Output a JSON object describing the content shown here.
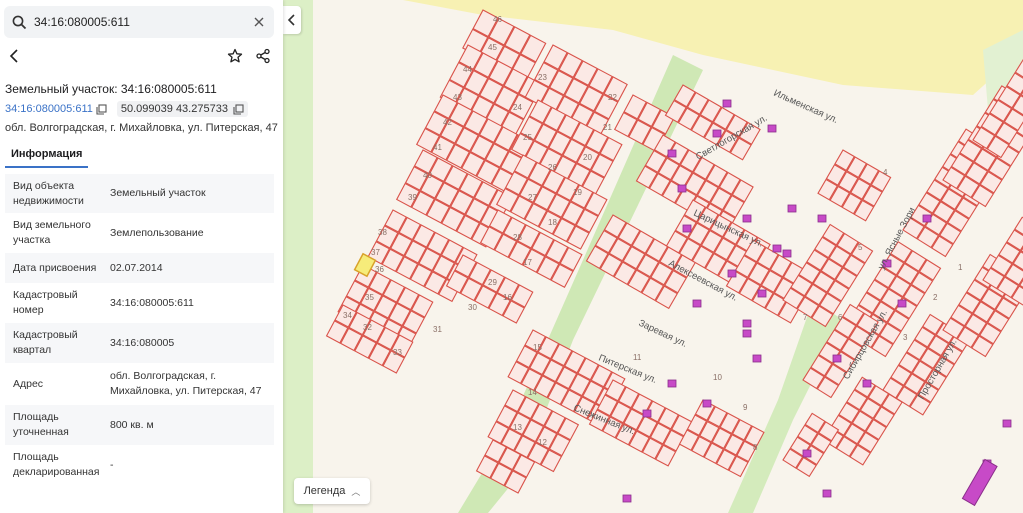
{
  "search": {
    "value": "34:16:080005:611",
    "placeholder": ""
  },
  "card": {
    "title": "Земельный участок: 34:16:080005:611",
    "cadastral_number": "34:16:080005:611",
    "coordinates": "50.099039 43.275733",
    "address": "обл. Волгоградская, г. Михайловка, ул. Питерская, 47"
  },
  "tabs": [
    {
      "label": "Информация"
    }
  ],
  "properties": [
    {
      "key": "Вид объекта недвижимости",
      "value": "Земельный участок"
    },
    {
      "key": "Вид земельного участка",
      "value": "Землепользование"
    },
    {
      "key": "Дата присвоения",
      "value": "02.07.2014"
    },
    {
      "key": "Кадастровый номер",
      "value": "34:16:080005:611"
    },
    {
      "key": "Кадастровый квартал",
      "value": "34:16:080005"
    },
    {
      "key": "Адрес",
      "value": "обл. Волгоградская, г. Михайловка, ул. Питерская, 47"
    },
    {
      "key": "Площадь уточненная",
      "value": "800 кв. м"
    },
    {
      "key": "Площадь декларированная",
      "value": "-"
    }
  ],
  "map": {
    "streets": [
      "Ильменская ул.",
      "Светлогорская ул.",
      "Царицынская ул.",
      "Алексеевская ул.",
      "Заревая ул.",
      "Питерская ул.",
      "Снежинная ул.",
      "ул. Ясные Зори",
      "Сибирцовская ул.",
      "Просторная ул."
    ],
    "parcel_labels": [
      "46",
      "45",
      "44",
      "43",
      "42",
      "41",
      "40",
      "39",
      "38",
      "37",
      "36",
      "35",
      "34",
      "33",
      "32",
      "31",
      "30",
      "29",
      "28",
      "27",
      "26",
      "25",
      "24",
      "23",
      "22",
      "21",
      "20",
      "19",
      "18",
      "17",
      "16",
      "15",
      "14",
      "13",
      "12",
      "11",
      "10",
      "9",
      "8",
      "7",
      "6",
      "5",
      "4",
      "3",
      "2",
      "1"
    ]
  },
  "legend": {
    "label": "Легенда"
  },
  "colors": {
    "parcel_stroke": "#d9534a",
    "parcel_fill": "#fbe9e5",
    "building": "#c74ac7",
    "green": "#cde9b4",
    "field": "#f7f1b3",
    "link": "#3a72c7"
  }
}
